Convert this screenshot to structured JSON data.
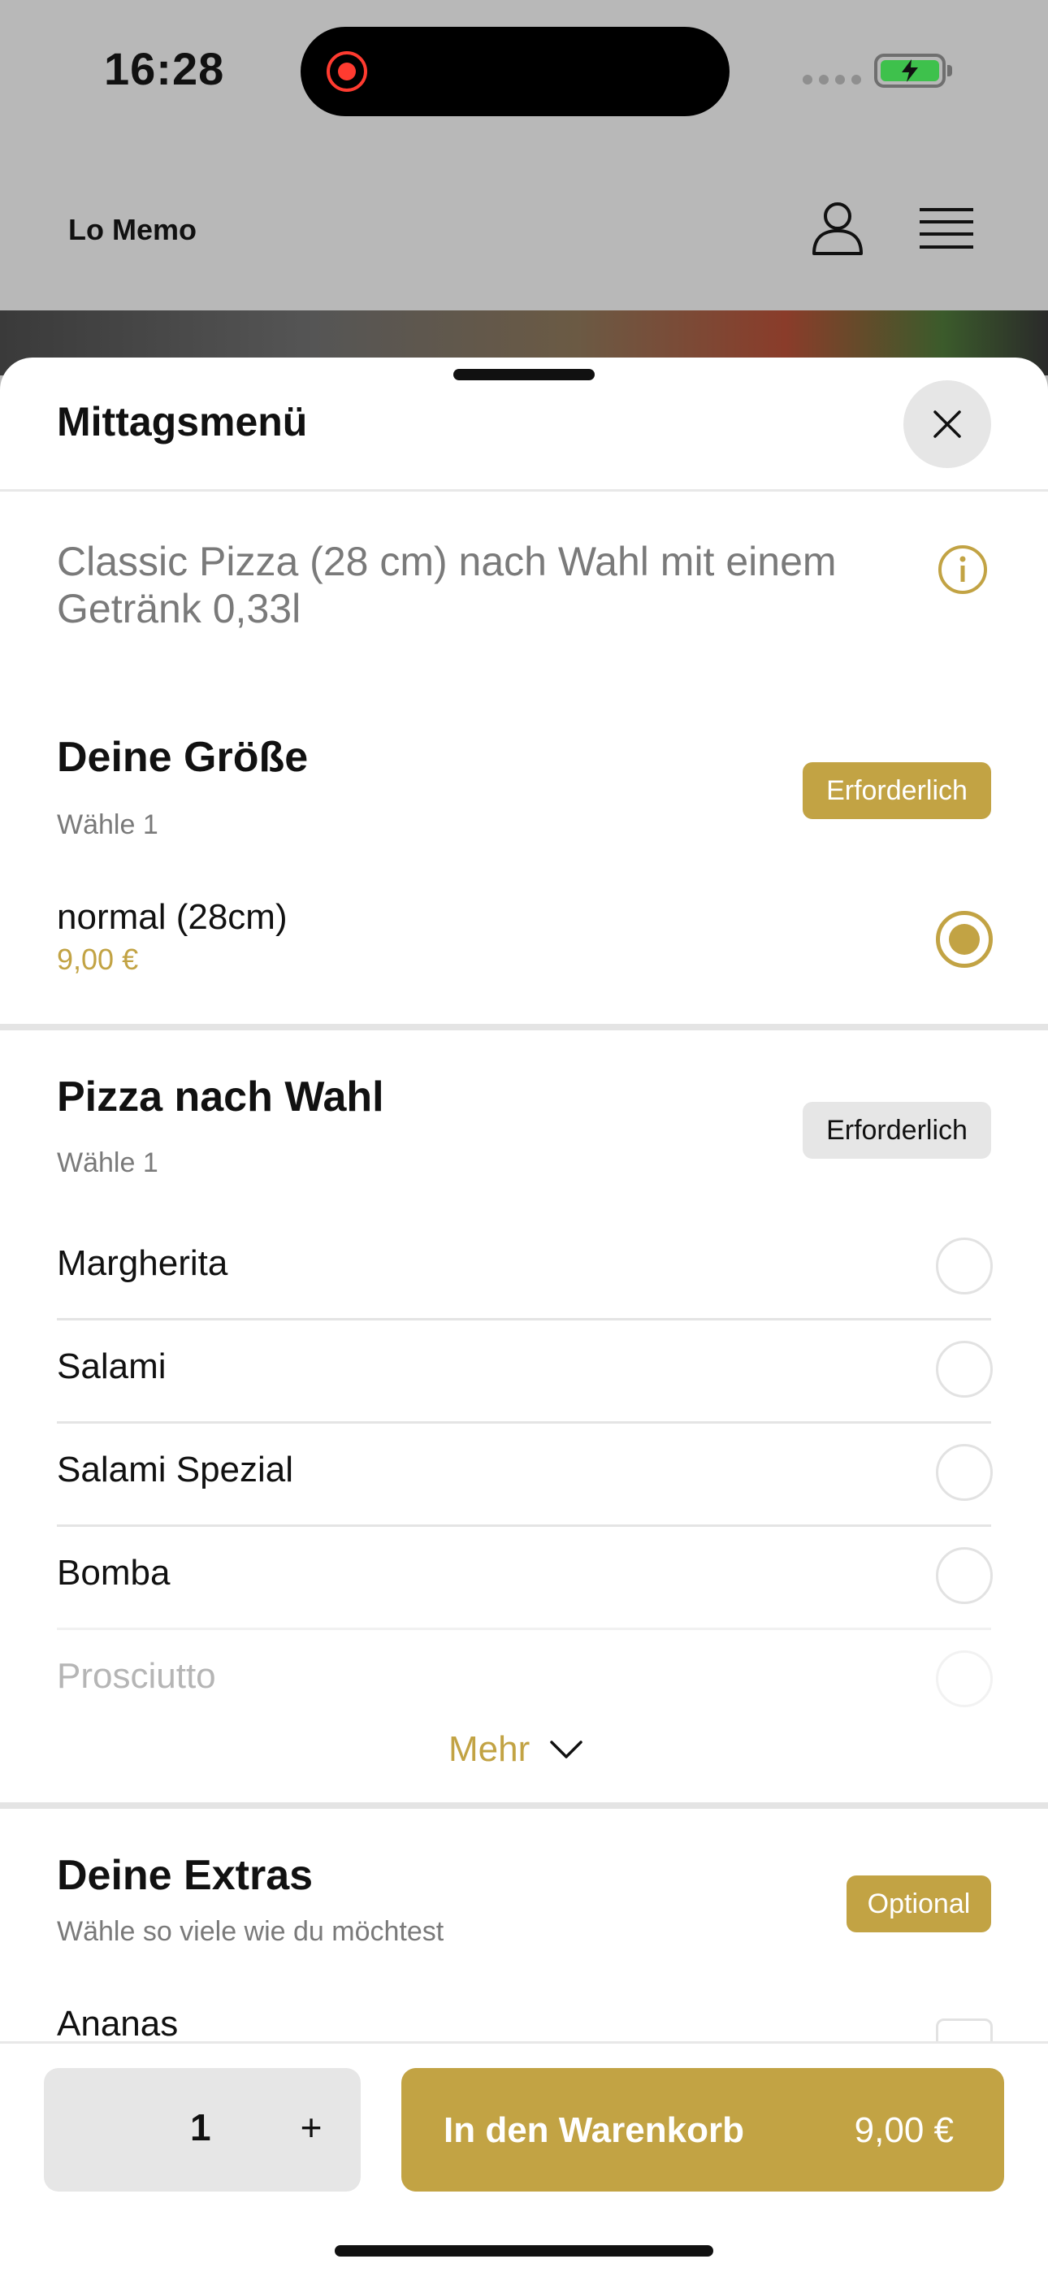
{
  "status_bar": {
    "time": "16:28"
  },
  "header": {
    "brand": "Lo Memo"
  },
  "sheet": {
    "title": "Mittagsmenü",
    "description": "Classic Pizza (28 cm) nach Wahl mit einem Getränk 0,33l"
  },
  "sections": {
    "size": {
      "title": "Deine Größe",
      "subtitle": "Wähle 1",
      "badge": "Erforderlich",
      "options": [
        {
          "label": "normal (28cm)",
          "price": "9,00 €",
          "selected": true
        }
      ]
    },
    "pizza": {
      "title": "Pizza nach Wahl",
      "subtitle": "Wähle 1",
      "badge": "Erforderlich",
      "options": [
        {
          "label": "Margherita"
        },
        {
          "label": "Salami"
        },
        {
          "label": "Salami Spezial"
        },
        {
          "label": "Bomba"
        },
        {
          "label": "Prosciutto"
        }
      ],
      "more_label": "Mehr"
    },
    "extras": {
      "title": "Deine Extras",
      "subtitle": "Wähle so viele wie du möchtest",
      "badge": "Optional",
      "options": [
        {
          "label": "Ananas"
        }
      ]
    }
  },
  "bottom_bar": {
    "quantity": "1",
    "plus": "+",
    "cart_label": "In den Warenkorb",
    "cart_price": "9,00 €"
  },
  "colors": {
    "accent": "#c2a344",
    "badge_grey": "#e6e6e6",
    "text": "#111111",
    "muted": "#7a7a7a"
  }
}
